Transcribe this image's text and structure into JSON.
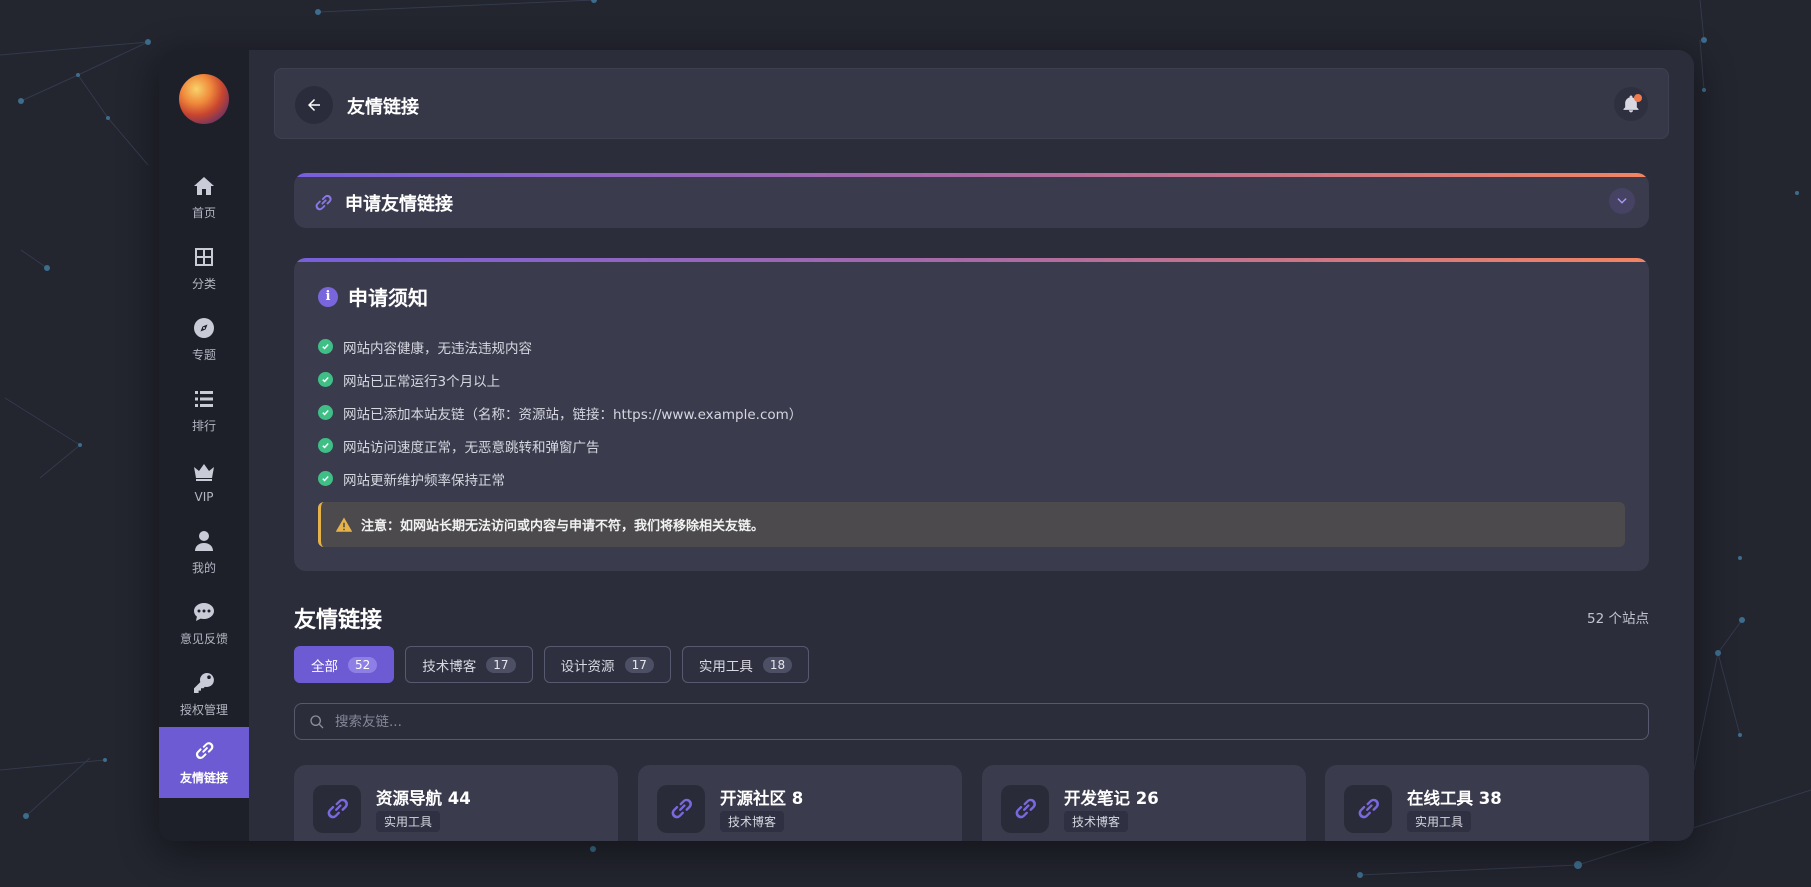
{
  "sidebar": {
    "items": [
      {
        "label": "首页",
        "icon": "home-icon"
      },
      {
        "label": "分类",
        "icon": "grid-icon"
      },
      {
        "label": "专题",
        "icon": "compass-icon"
      },
      {
        "label": "排行",
        "icon": "list-icon"
      },
      {
        "label": "VIP",
        "icon": "crown-icon"
      },
      {
        "label": "我的",
        "icon": "user-icon"
      },
      {
        "label": "意见反馈",
        "icon": "chat-icon"
      },
      {
        "label": "授权管理",
        "icon": "key-icon"
      },
      {
        "label": "友情链接",
        "icon": "link-icon",
        "active": true
      }
    ]
  },
  "header": {
    "title": "友情链接"
  },
  "apply": {
    "title": "申请友情链接"
  },
  "notice": {
    "title": "申请须知",
    "rules": [
      "网站内容健康，无违法违规内容",
      "网站已正常运行3个月以上",
      "网站已添加本站友链（名称：资源站，链接：https://www.example.com）",
      "网站访问速度正常，无恶意跳转和弹窗广告",
      "网站更新维护频率保持正常"
    ],
    "warning": "注意：如网站长期无法访问或内容与申请不符，我们将移除相关友链。"
  },
  "links": {
    "title": "友情链接",
    "count_text": "52 个站点",
    "filters": [
      {
        "label": "全部",
        "count": "52",
        "active": true
      },
      {
        "label": "技术博客",
        "count": "17"
      },
      {
        "label": "设计资源",
        "count": "17"
      },
      {
        "label": "实用工具",
        "count": "18"
      }
    ],
    "search_placeholder": "搜索友链...",
    "sites": [
      {
        "name": "资源导航 44",
        "tag": "实用工具"
      },
      {
        "name": "开源社区 8",
        "tag": "技术博客"
      },
      {
        "name": "开发笔记 26",
        "tag": "技术博客"
      },
      {
        "name": "在线工具 38",
        "tag": "实用工具"
      }
    ]
  },
  "colors": {
    "accent": "#6c5bd3",
    "gradient_start": "#7760db",
    "gradient_end": "#f38463",
    "success": "#3fbf86",
    "warning": "#e6b34a"
  }
}
